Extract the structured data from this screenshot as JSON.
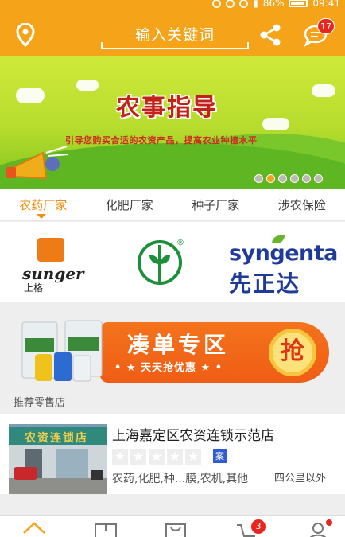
{
  "status": {
    "battery": "86%",
    "time": "09:41"
  },
  "header": {
    "search_placeholder": "输入关键词",
    "message_count": "17"
  },
  "banner": {
    "title": "农事指导",
    "subtitle": "引导您购买合适的农资产品，提高农业种植水平",
    "slide_count": 6,
    "active_slide": 2
  },
  "tabs": [
    {
      "label": "农药厂家",
      "active": true
    },
    {
      "label": "化肥厂家",
      "active": false
    },
    {
      "label": "种子厂家",
      "active": false
    },
    {
      "label": "涉农保险",
      "active": false
    }
  ],
  "brands": {
    "sunger": {
      "name": "sunger",
      "cn": "上格"
    },
    "green": {
      "name": "green-logo"
    },
    "syngenta": {
      "name": "syngenta",
      "cn": "先正达"
    }
  },
  "promo": {
    "title": "凑单专区",
    "subtitle": "• ★ 天天抢优惠 ★ •",
    "button": "抢"
  },
  "retail": {
    "section_title": "推荐零售店",
    "store": {
      "name": "上海嘉定区农资连锁示范店",
      "auth": "案",
      "tags": "农药,化肥,种...膜,农机,其他",
      "distance": "四公里以外",
      "sign": "农资连锁店"
    }
  },
  "nav": {
    "cart_count": "3"
  },
  "colors": {
    "primary": "#f5a319",
    "accent": "#f08e0d",
    "red": "#e8251f",
    "blue": "#1f3b9a"
  }
}
